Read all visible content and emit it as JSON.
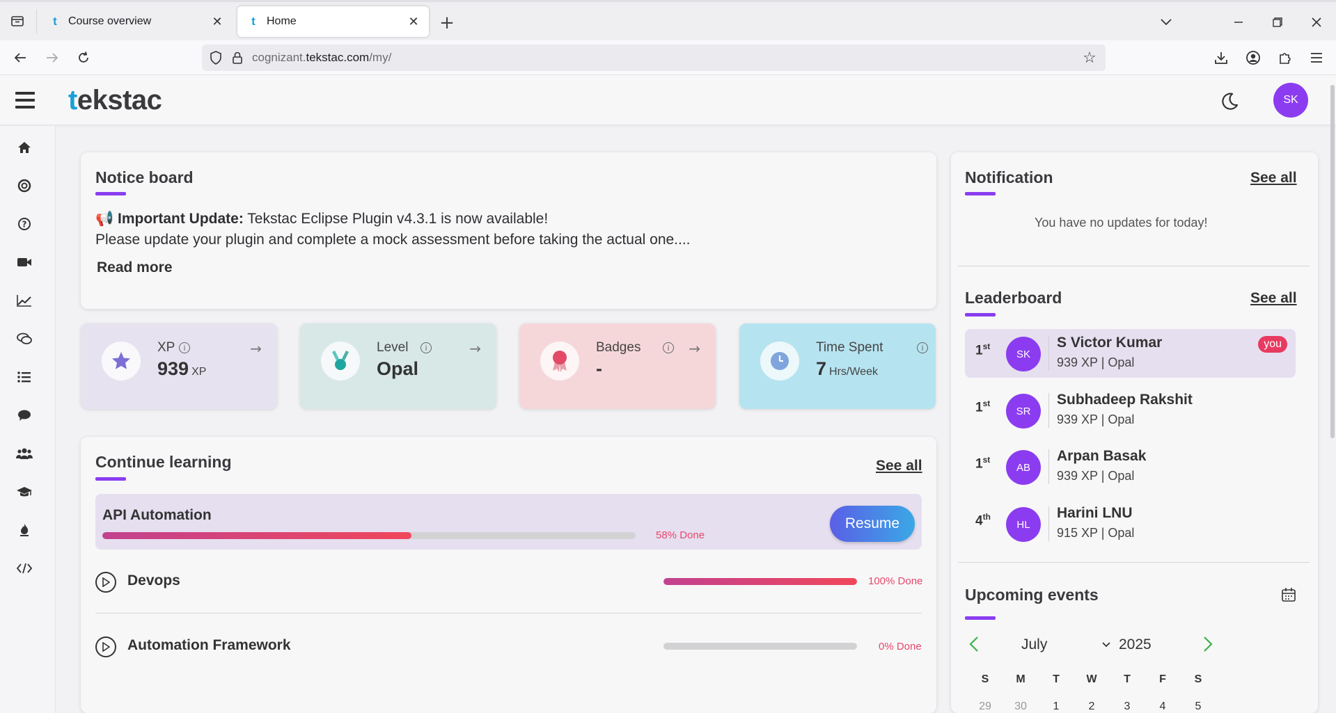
{
  "browser": {
    "tabs": [
      {
        "label": "Course overview",
        "active": false
      },
      {
        "label": "Home",
        "active": true
      }
    ],
    "url_prefix": "cognizant.",
    "url_domain": "tekstac.com",
    "url_path": "/my/"
  },
  "app": {
    "logo_t": "t",
    "logo_rest": "ekstac",
    "user_initials": "SK"
  },
  "notice": {
    "title": "Notice board",
    "emoji": "📢",
    "bold": "Important Update:",
    "line1": " Tekstac Eclipse Plugin v4.3.1 is now available!",
    "line2": "Please update your plugin and complete a mock assessment before taking the actual one....",
    "read_more": "Read more"
  },
  "stats": [
    {
      "label": "XP",
      "value": "939",
      "unit": "XP",
      "bg": "#e6e2f0",
      "icon": "star-icon"
    },
    {
      "label": "Level",
      "value": "Opal",
      "unit": "",
      "bg": "#d8e8e6",
      "icon": "medal-icon"
    },
    {
      "label": "Badges",
      "value": "-",
      "unit": "",
      "bg": "#f5d7da",
      "icon": "badge-icon"
    },
    {
      "label": "Time Spent",
      "value": "7",
      "unit": "Hrs/Week",
      "bg": "#b6e3f0",
      "icon": "clock-icon"
    }
  ],
  "continue_learning": {
    "title": "Continue learning",
    "see_all": "See all",
    "resume": "Resume",
    "courses": [
      {
        "name": "API Automation",
        "progress": 58,
        "done_label": "58% Done"
      },
      {
        "name": "Devops",
        "progress": 100,
        "done_label": "100% Done"
      },
      {
        "name": "Automation Framework",
        "progress": 0,
        "done_label": "0% Done"
      }
    ]
  },
  "notification": {
    "title": "Notification",
    "see_all": "See all",
    "empty": "You have no updates for today!"
  },
  "leaderboard": {
    "title": "Leaderboard",
    "see_all": "See all",
    "you_label": "you",
    "rows": [
      {
        "rank": "1",
        "suffix": "st",
        "initials": "SK",
        "name": "S Victor Kumar",
        "sub": "939 XP | Opal"
      },
      {
        "rank": "1",
        "suffix": "st",
        "initials": "SR",
        "name": "Subhadeep Rakshit",
        "sub": "939 XP | Opal"
      },
      {
        "rank": "1",
        "suffix": "st",
        "initials": "AB",
        "name": "Arpan Basak",
        "sub": "939 XP | Opal"
      },
      {
        "rank": "4",
        "suffix": "th",
        "initials": "HL",
        "name": "Harini LNU",
        "sub": "915 XP | Opal"
      }
    ]
  },
  "events": {
    "title": "Upcoming events",
    "month": "July",
    "year": "2025",
    "weekdays": [
      "S",
      "M",
      "T",
      "W",
      "T",
      "F",
      "S"
    ],
    "first_row": [
      "29",
      "30",
      "1",
      "2",
      "3",
      "4",
      "5"
    ]
  },
  "colors": {
    "accent": "#8a3df0",
    "avatar": "#8c3cf0",
    "done_text": "#e8476a",
    "calendar_nav": "#3cb04a"
  }
}
